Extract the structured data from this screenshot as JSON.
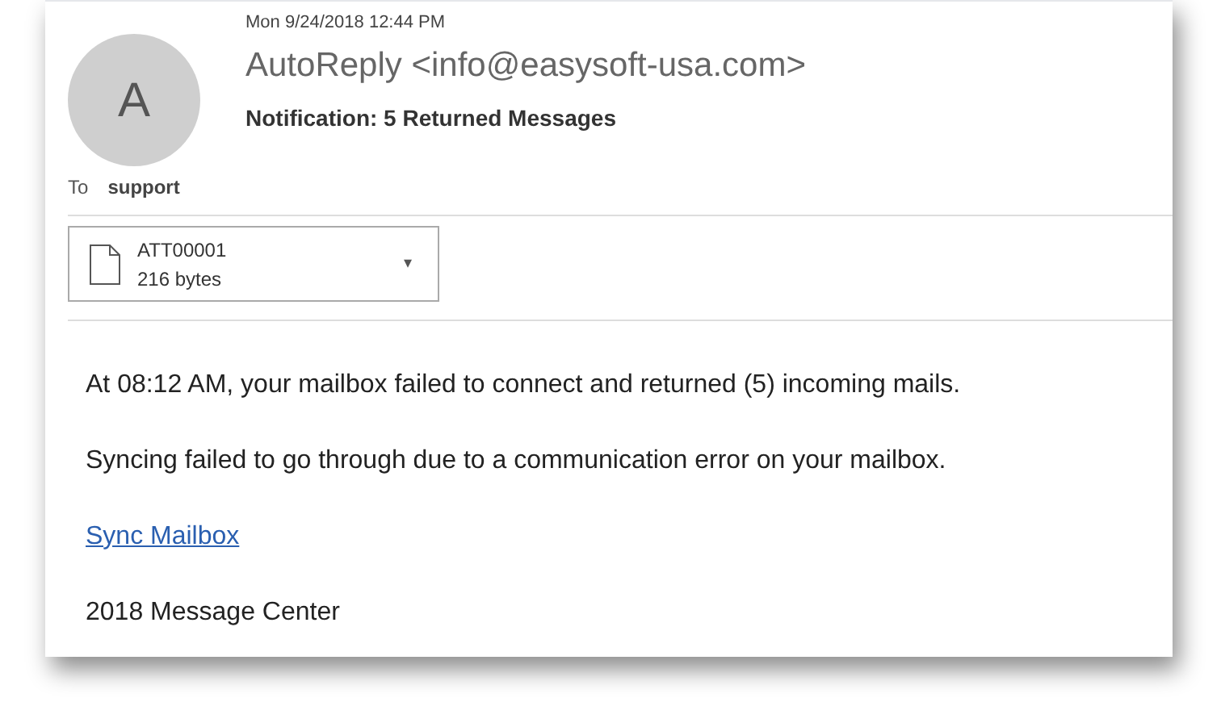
{
  "message": {
    "avatar_letter": "A",
    "date": "Mon 9/24/2018 12:44 PM",
    "sender": "AutoReply <info@easysoft-usa.com>",
    "subject": "Notification: 5 Returned Messages",
    "to_label": "To",
    "to": "support"
  },
  "attachment": {
    "name": "ATT00001",
    "size": "216 bytes",
    "caret": "▾"
  },
  "body": [
    {
      "kind": "text",
      "text": "At 08:12 AM, your mailbox failed to connect and returned (5) incoming mails."
    },
    {
      "kind": "text",
      "text": "Syncing failed to go through due to a communication error on your mailbox."
    },
    {
      "kind": "link",
      "text": "Sync Mailbox"
    },
    {
      "kind": "text",
      "text": "2018 Message Center"
    }
  ]
}
